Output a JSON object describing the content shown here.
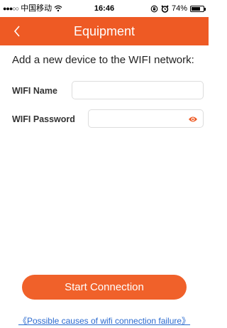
{
  "status_bar": {
    "signal": "●●●○○",
    "carrier": "中国移动",
    "wifi_icon": "wifi-icon",
    "time": "16:46",
    "lock_icon": "orientation-lock-icon",
    "alarm_icon": "alarm-icon",
    "battery_percent": "74%",
    "battery_level": 0.74
  },
  "nav": {
    "back_label": "<",
    "title": "Equipment"
  },
  "main": {
    "intro": "Add a new device to the WIFI network:",
    "wifi_name_label": "WIFI Name",
    "wifi_name_value": "",
    "wifi_password_label": "WIFI Password",
    "wifi_password_value": "",
    "eye_icon": "eye-icon",
    "start_button_label": "Start Connection",
    "help_link": "《Possible causes of wifi connection failure》"
  },
  "colors": {
    "accent": "#EE5A24",
    "button": "#F0612A",
    "link": "#2A6ACF"
  }
}
